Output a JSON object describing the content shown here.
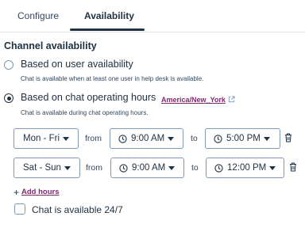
{
  "tabs": [
    {
      "label": "Configure"
    },
    {
      "label": "Availability"
    }
  ],
  "section_title": "Channel availability",
  "options": [
    {
      "label": "Based on user availability",
      "help": "Chat is available when at least one user in help desk is available.",
      "selected": false
    },
    {
      "label": "Based on chat operating hours",
      "help": "Chat is available during chat operating hours.",
      "selected": true
    }
  ],
  "timezone_link": "America/New_York",
  "rows": [
    {
      "days": "Mon - Fri",
      "from_word": "from",
      "start": "9:00 AM",
      "to_word": "to",
      "end": "5:00 PM"
    },
    {
      "days": "Sat - Sun",
      "from_word": "from",
      "start": "9:00 AM",
      "to_word": "to",
      "end": "12:00 PM"
    }
  ],
  "add_hours": {
    "plus": "+",
    "label": "Add hours"
  },
  "always_available": {
    "label": "Chat is available 24/7",
    "checked": false
  },
  "colors": {
    "link": "#7c2a6e",
    "text": "#213343",
    "border": "#7c98b6"
  }
}
